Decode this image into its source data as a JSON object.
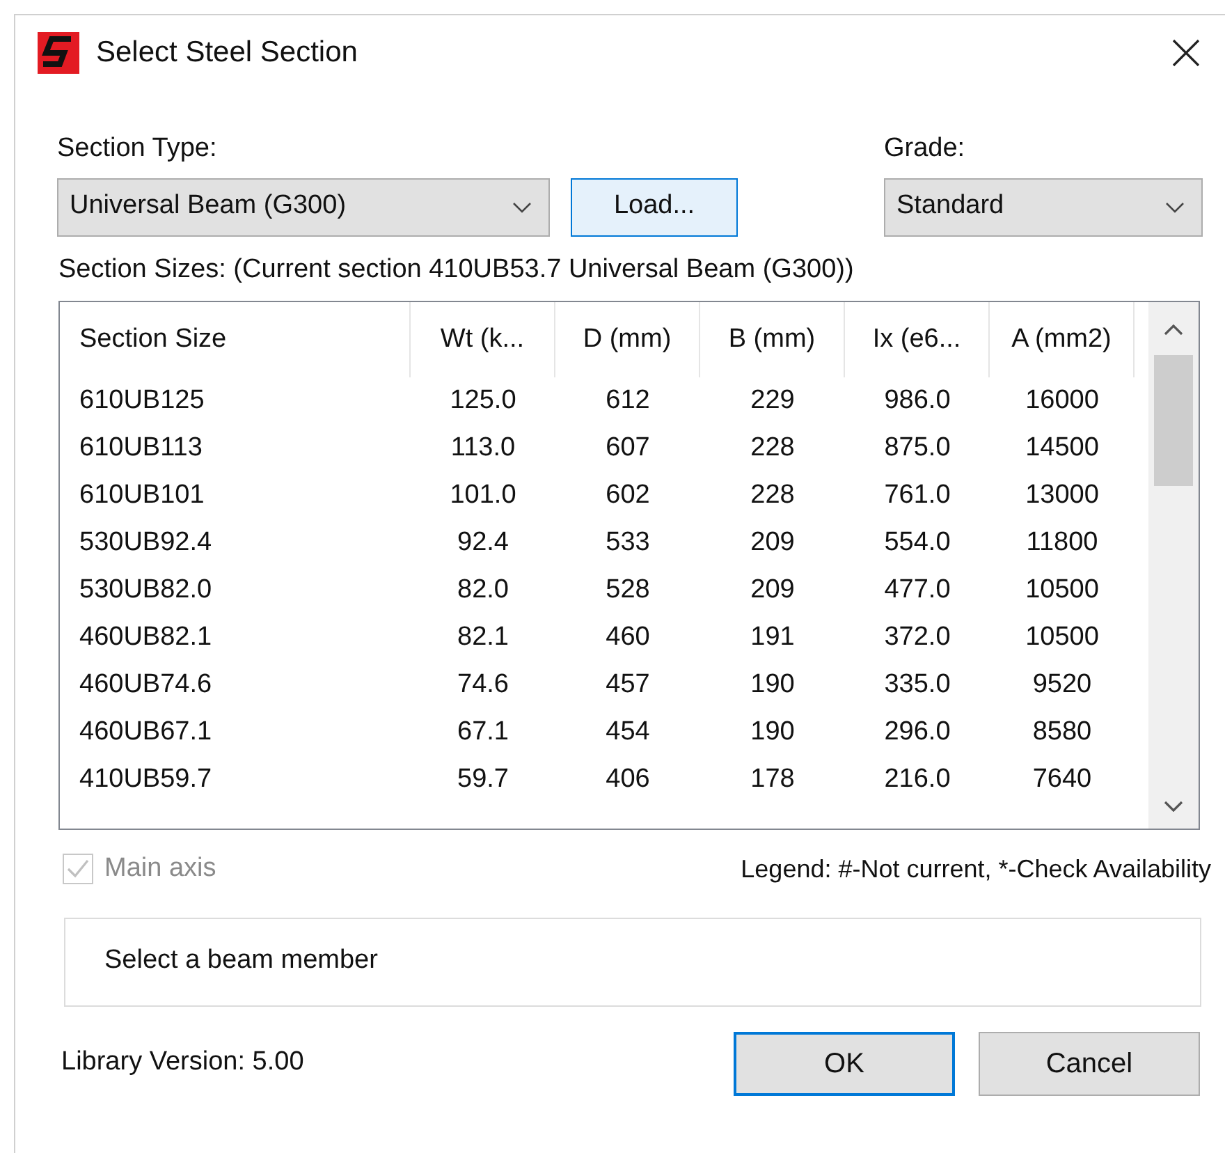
{
  "window": {
    "title": "Select Steel Section"
  },
  "section_type": {
    "label": "Section Type:",
    "value": "Universal Beam (G300)"
  },
  "load_button": "Load...",
  "grade": {
    "label": "Grade:",
    "value": "Standard"
  },
  "sizes_label": "Section Sizes: (Current section 410UB53.7 Universal Beam (G300))",
  "table": {
    "columns": [
      "Section Size",
      "Wt (k...",
      "D (mm)",
      "B (mm)",
      "Ix (e6...",
      "A (mm2)"
    ],
    "rows": [
      [
        "610UB125",
        "125.0",
        "612",
        "229",
        "986.0",
        "16000"
      ],
      [
        "610UB113",
        "113.0",
        "607",
        "228",
        "875.0",
        "14500"
      ],
      [
        "610UB101",
        "101.0",
        "602",
        "228",
        "761.0",
        "13000"
      ],
      [
        "530UB92.4",
        "92.4",
        "533",
        "209",
        "554.0",
        "11800"
      ],
      [
        "530UB82.0",
        "82.0",
        "528",
        "209",
        "477.0",
        "10500"
      ],
      [
        "460UB82.1",
        "82.1",
        "460",
        "191",
        "372.0",
        "10500"
      ],
      [
        "460UB74.6",
        "74.6",
        "457",
        "190",
        "335.0",
        "9520"
      ],
      [
        "460UB67.1",
        "67.1",
        "454",
        "190",
        "296.0",
        "8580"
      ],
      [
        "410UB59.7",
        "59.7",
        "406",
        "178",
        "216.0",
        "7640"
      ]
    ]
  },
  "main_axis": {
    "label": "Main axis",
    "checked": true,
    "disabled": true
  },
  "legend": "Legend: #-Not current, *-Check Availability",
  "message": "Select a beam member",
  "library_version": "Library Version: 5.00",
  "buttons": [
    {
      "label": "OK",
      "selected": true
    },
    {
      "label": "Cancel",
      "selected": false
    }
  ]
}
